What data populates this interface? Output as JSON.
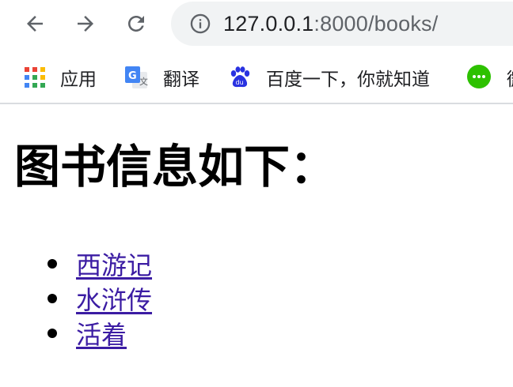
{
  "browser": {
    "url_host": "127.0.0.1",
    "url_rest": ":8000/books/"
  },
  "bookmarks": [
    {
      "label": "应用",
      "icon": "apps-grid-icon"
    },
    {
      "label": "翻译",
      "icon": "google-translate-icon"
    },
    {
      "label": "百度一下，你就知道",
      "icon": "baidu-paw-icon"
    },
    {
      "label": "微",
      "icon": "wechat-icon"
    }
  ],
  "page": {
    "heading": "图书信息如下：",
    "books": [
      "西游记",
      "水浒传",
      "活着"
    ]
  },
  "colors": {
    "link": "#3b1ca3",
    "omnibox_bg": "#f1f3f4",
    "wechat_green": "#2dc100",
    "baidu_blue": "#2932e1"
  }
}
